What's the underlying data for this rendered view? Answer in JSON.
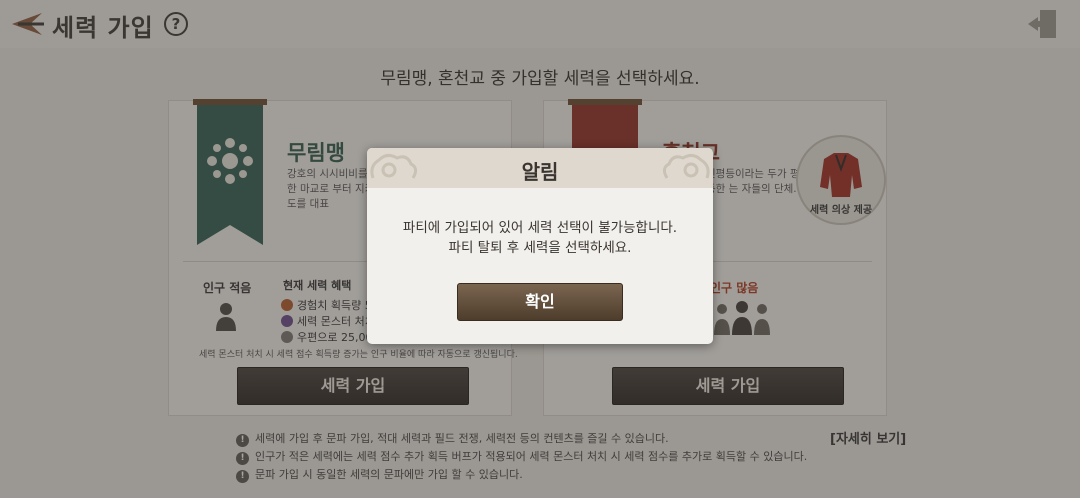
{
  "header": {
    "title": "세력 가입",
    "help_label": "?"
  },
  "prompt": "무림맹, 혼천교 중 가입할 세력을 선택하세요.",
  "factions": {
    "left": {
      "name": "무림맹",
      "description": "강호의 시시비비를 사독한 마교로 부터 지키는 백도를 대표",
      "population_label": "인구 적음",
      "benefits_title": "현재 세력 혜택",
      "benefits": [
        "경험치 획득량 5",
        "세력 몬스터 처치",
        "우편으로 25,00"
      ],
      "benefit_note": "세력 몬스터 처치 시 세력 점수 획득량 증가는 인구 비율에 따라 자동으로 갱신됩니다.",
      "join_label": "세력 가입"
    },
    "right": {
      "name": "혼천교",
      "description": "민평등이라는 두가 평등한 는 자들의 단체.",
      "costume_label": "세력 의상 제공",
      "population_label": "인구 많음",
      "join_label": "세력 가입"
    }
  },
  "footer": {
    "notes": [
      "세력에 가입 후 문파 가입, 적대 세력과 필드 전쟁, 세력전 등의 컨텐츠를 즐길 수 있습니다.",
      "인구가 적은 세력에는 세력 점수 추가 획득 버프가 적용되어 세력 몬스터 처치 시 세력 점수를 추가로 획득할 수 있습니다.",
      "문파 가입 시 동일한 세력의 문파에만 가입 할 수 있습니다."
    ],
    "detail_link": "[자세히 보기]"
  },
  "modal": {
    "title": "알림",
    "message_line1": "파티에 가입되어 있어 세력 선택이 불가능합니다.",
    "message_line2": "파티 탈퇴 후 세력을 선택하세요.",
    "ok_label": "확인"
  },
  "colors": {
    "green_banner": "#2f5e50",
    "red_banner": "#8e2d22",
    "button_dark": "#2a2521",
    "ok_button": "#5e4a37"
  },
  "icons": [
    "back-arrow-icon",
    "help-icon",
    "exit-door-icon",
    "flower-emblem-icon",
    "person-icon",
    "crowd-icon",
    "exp-icon",
    "monster-icon",
    "mail-icon",
    "warning-icon"
  ]
}
